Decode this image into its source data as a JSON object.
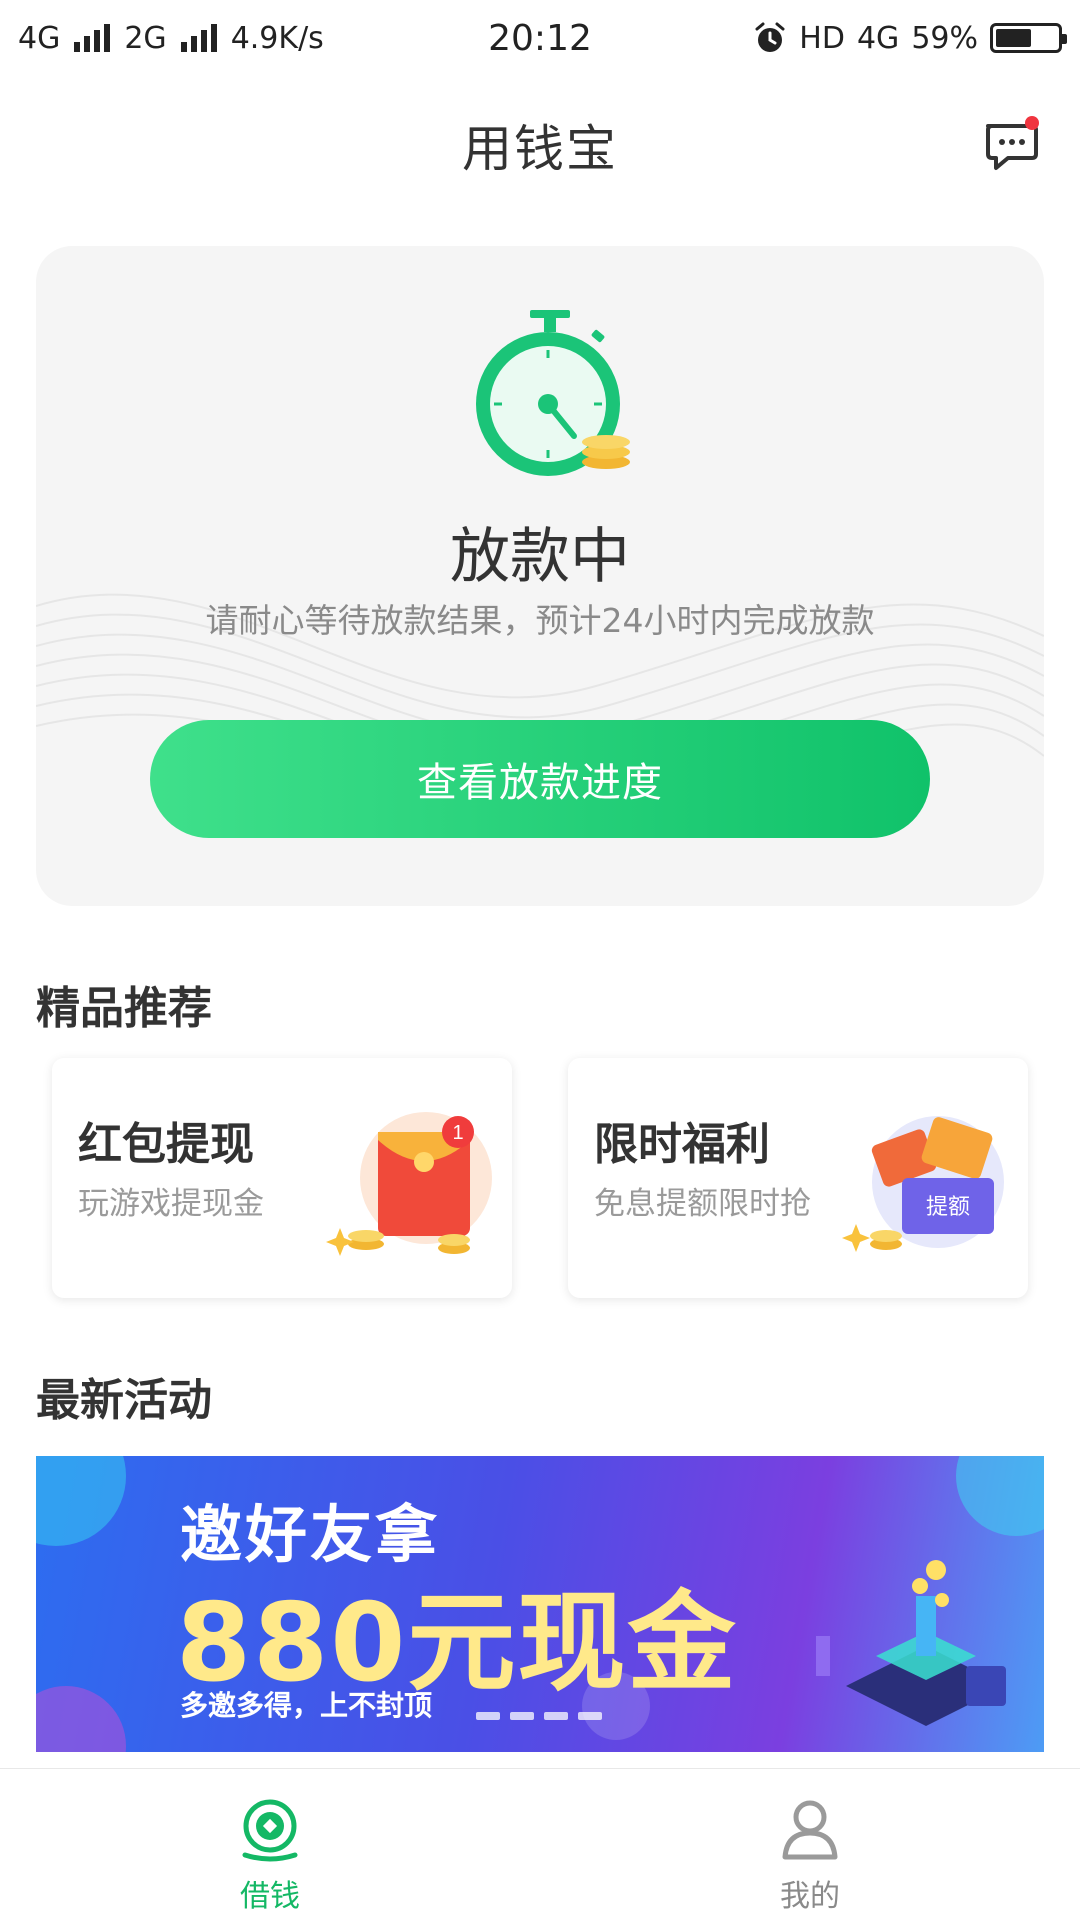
{
  "status_bar": {
    "network_1": "4G",
    "network_2": "2G",
    "speed": "4.9K/s",
    "time": "20:12",
    "hd": "HD",
    "network_3": "4G",
    "battery_text": "59%",
    "battery_level": 0.59
  },
  "header": {
    "title": "用钱宝"
  },
  "loan_status": {
    "title": "放款中",
    "description": "请耐心等待放款结果，预计24小时内完成放款",
    "button_label": "查看放款进度"
  },
  "recommend": {
    "section_title": "精品推荐",
    "items": [
      {
        "title": "红包提现",
        "subtitle": "玩游戏提现金",
        "badge": "1"
      },
      {
        "title": "限时福利",
        "subtitle": "免息提额限时抢",
        "tag": "提额"
      }
    ]
  },
  "activities": {
    "section_title": "最新活动",
    "banner": {
      "line1": "邀好友拿",
      "line2": "880元现金",
      "line3": "多邀多得，上不封顶"
    }
  },
  "bottom_nav": {
    "items": [
      {
        "label": "借钱",
        "active": true
      },
      {
        "label": "我的",
        "active": false
      }
    ]
  },
  "colors": {
    "accent": "#14b865",
    "button_start": "#3fe08b",
    "button_end": "#10c26a",
    "notification_dot": "#f0353f"
  }
}
